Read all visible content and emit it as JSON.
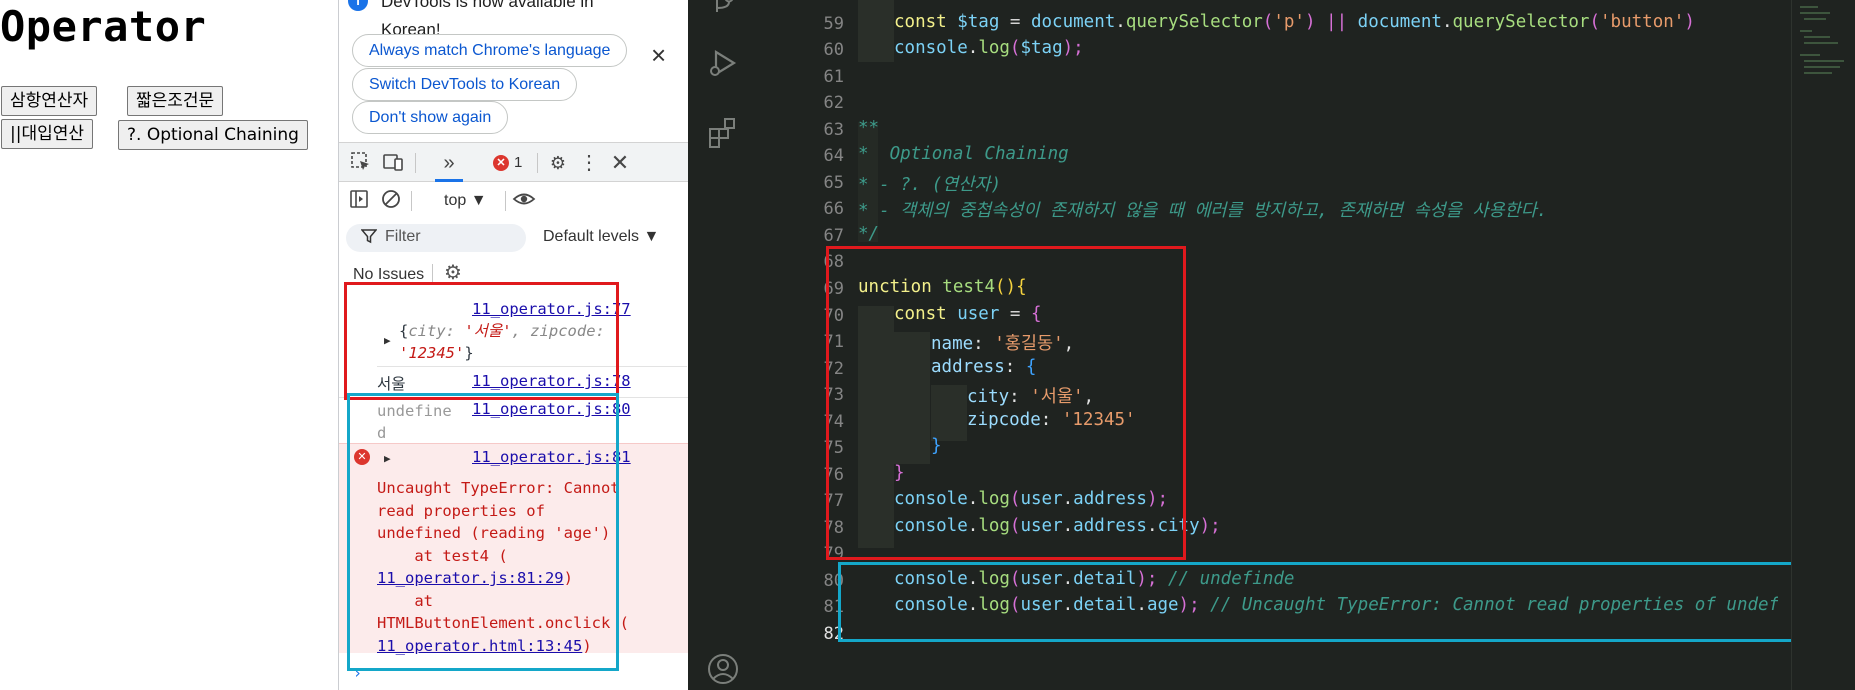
{
  "page": {
    "title": "Operator",
    "buttons": [
      "삼항연산자",
      "짧은조건문",
      "||대입연산",
      "?. Optional Chaining"
    ]
  },
  "devtools": {
    "banner": {
      "info_text": "DevTools is now available in Korean!",
      "options": [
        "Always match Chrome's language",
        "Switch DevTools to Korean",
        "Don't show again"
      ]
    },
    "toolbar": {
      "error_count": "1"
    },
    "console_toolbar": {
      "context": "top ▼"
    },
    "filter": {
      "placeholder": "Filter",
      "levels": "Default levels ▼"
    },
    "issues": "No Issues",
    "messages": {
      "m1": {
        "source": "11_operator.js:77",
        "obj_open": "{",
        "k1": "city",
        "v1": "'서울'",
        "k2": "zipcode",
        "v2": "'12345'",
        "obj_close": "}"
      },
      "m2": {
        "value": "서울",
        "source": "11_operator.js:78"
      },
      "m3": {
        "value": "undefined",
        "source": "11_operator.js:80"
      },
      "m4": {
        "source": "11_operator.js:81",
        "l1": "Uncaught TypeError: Cannot",
        "l2": "read properties of",
        "l3": "undefined (reading 'age')",
        "l4": "    at test4 (",
        "l5_link": "11_operator.js:81:29",
        "l5_tail": ")",
        "l6": "    at",
        "l7": "HTMLButtonElement.onclick (",
        "l8_link": "11_operator.html:13:45",
        "l8_tail": ")"
      }
    }
  },
  "editor": {
    "line_numbers": [
      "59",
      "60",
      "61",
      "62",
      "63",
      "64",
      "65",
      "66",
      "67",
      "68",
      "69",
      "70",
      "71",
      "72",
      "73",
      "74",
      "75",
      "76",
      "77",
      "78",
      "79",
      "80",
      "81",
      "82"
    ],
    "active_line": "82",
    "code": {
      "l59_const": "const ",
      "l59_var": "$tag",
      "l59_eq": " = ",
      "l59_doc": "document",
      "l59_dot": ".",
      "l59_fn": "querySelector",
      "l59_p1": "(",
      "l59_s1": "'p'",
      "l59_p2": ")",
      "l59_or": " || ",
      "l59_doc2": "document",
      "l59_dot2": ".",
      "l59_fn2": "querySelector",
      "l59_p3": "(",
      "l59_s2": "'button'",
      "l59_p4": ")",
      "l60_console": "console",
      "l60_dot": ".",
      "l60_log": "log",
      "l60_p1": "(",
      "l60_var": "$tag",
      "l60_p2": ");",
      "l63": "**",
      "l64": "*  Optional Chaining",
      "l65": "* - ?. (연산자)",
      "l66": "* - 객체의 중첩속성이 존재하지 않을 때 에러를 방지하고, 존재하면 속성을 사용한다.",
      "l67": "*/",
      "l69_kw": "unction ",
      "l69_fn": "test4",
      "l69_p": "()",
      "l69_b": "{",
      "l70_kw": "const ",
      "l70_var": "user",
      "l70_eq": " = ",
      "l70_b": "{",
      "l71_k": "name",
      "l71_c": ": ",
      "l71_s": "'홍길동'",
      "l71_t": ",",
      "l72_k": "address",
      "l72_c": ": ",
      "l72_b": "{",
      "l73_k": "city",
      "l73_c": ": ",
      "l73_s": "'서울'",
      "l73_t": ",",
      "l74_k": "zipcode",
      "l74_c": ": ",
      "l74_s": "'12345'",
      "l75_b": "}",
      "l76_b": "}",
      "l77_c": "console",
      "l77_d": ".",
      "l77_f": "log",
      "l77_p1": "(",
      "l77_v": "user",
      "l77_d2": ".",
      "l77_pr": "address",
      "l77_p2": ");",
      "l78_c": "console",
      "l78_d": ".",
      "l78_f": "log",
      "l78_p1": "(",
      "l78_v": "user",
      "l78_d2": ".",
      "l78_pr": "address",
      "l78_d3": ".",
      "l78_pr2": "city",
      "l78_p2": ");",
      "l80_c": "console",
      "l80_d": ".",
      "l80_f": "log",
      "l80_p1": "(",
      "l80_v": "user",
      "l80_d2": ".",
      "l80_pr": "detail",
      "l80_p2": ");",
      "l80_cm": " // undefinde",
      "l81_c": "console",
      "l81_d": ".",
      "l81_f": "log",
      "l81_p1": "(",
      "l81_v": "user",
      "l81_d2": ".",
      "l81_pr": "detail",
      "l81_d3": ".",
      "l81_pr2": "age",
      "l81_p2": ");",
      "l81_cm": " // Uncaught TypeError: Cannot read properties of undef"
    }
  },
  "colors": {
    "annotation_red": "#e0191d",
    "annotation_cyan": "#14a7c9",
    "editor_bg": "#1f2320",
    "link": "#1a0dab",
    "error_bg": "#fcebeb"
  },
  "icons": [
    "info-icon",
    "close-icon",
    "inspect-icon",
    "device-icon",
    "more-panels-icon",
    "error-icon",
    "settings-icon",
    "kebab-menu-icon",
    "sidebar-toggle-icon",
    "clear-console-icon",
    "eye-icon",
    "filter-icon",
    "gear-icon",
    "expand-triangle-icon",
    "error-x-icon",
    "prompt-chevron-icon",
    "source-control-icon",
    "run-debug-icon",
    "extensions-icon",
    "account-icon"
  ]
}
